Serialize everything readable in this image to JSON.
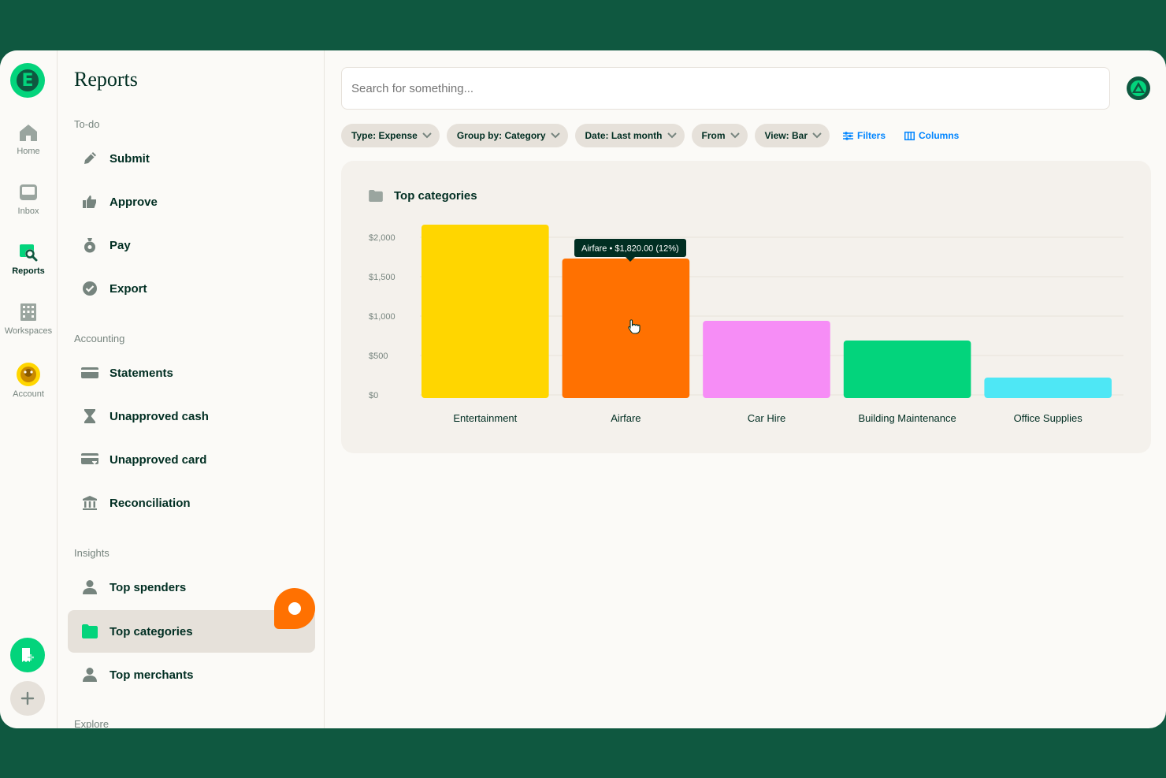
{
  "rail": {
    "items": [
      {
        "label": "Home",
        "icon": "home-icon"
      },
      {
        "label": "Inbox",
        "icon": "inbox-icon"
      },
      {
        "label": "Reports",
        "icon": "reports-icon",
        "active": true
      },
      {
        "label": "Workspaces",
        "icon": "building-icon"
      },
      {
        "label": "Account",
        "icon": "account-avatar-icon"
      }
    ]
  },
  "sidebar": {
    "title": "Reports",
    "sections": {
      "todo": "To-do",
      "accounting": "Accounting",
      "insights": "Insights",
      "explore": "Explore"
    },
    "todo_items": [
      "Submit",
      "Approve",
      "Pay",
      "Export"
    ],
    "accounting_items": [
      "Statements",
      "Unapproved cash",
      "Unapproved card",
      "Reconciliation"
    ],
    "insights_items": [
      "Top spenders",
      "Top categories",
      "Top merchants"
    ],
    "active_item": "Top categories"
  },
  "search": {
    "placeholder": "Search for something..."
  },
  "filters": {
    "pills": [
      "Type: Expense",
      "Group by: Category",
      "Date: Last month",
      "From",
      "View: Bar"
    ],
    "filters_label": "Filters",
    "columns_label": "Columns"
  },
  "card": {
    "title": "Top categories"
  },
  "tooltip": {
    "text": "Airfare • $1,820.00 (12%)"
  },
  "colors": {
    "brand_dark": "#0f5840",
    "brand_green": "#03d47c",
    "link_blue": "#0185ff"
  },
  "chart_data": {
    "type": "bar",
    "categories": [
      "Entertainment",
      "Airfare",
      "Car Hire",
      "Building Maintenance",
      "Office Supplies"
    ],
    "values": [
      2160,
      1730,
      940,
      690,
      220
    ],
    "colors": [
      "#ffd600",
      "#ff7101",
      "#f68df6",
      "#03d47c",
      "#4ee7f5"
    ],
    "y_ticks": [
      "$0",
      "$500",
      "$1,000",
      "$1,500",
      "$2,000"
    ],
    "y_tick_values": [
      0,
      500,
      1000,
      1500,
      2000
    ],
    "ylim": [
      0,
      2000
    ],
    "grid": true,
    "highlighted": "Airfare"
  }
}
